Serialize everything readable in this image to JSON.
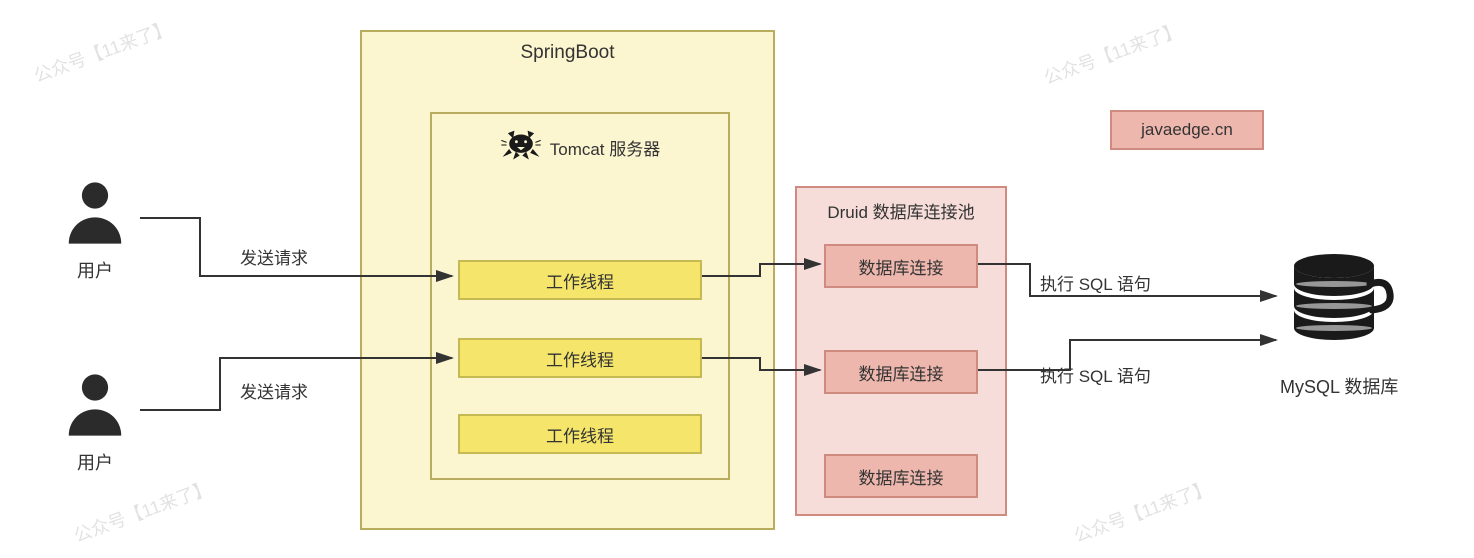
{
  "watermark": "公众号【11来了】",
  "users": {
    "label": "用户"
  },
  "springboot": {
    "title": "SpringBoot",
    "tomcat": {
      "title": "Tomcat 服务器",
      "workers": [
        "工作线程",
        "工作线程",
        "工作线程"
      ]
    }
  },
  "druid": {
    "title": "Druid 数据库连接池",
    "connections": [
      "数据库连接",
      "数据库连接",
      "数据库连接"
    ]
  },
  "mysql": {
    "label": "MySQL 数据库"
  },
  "badge": "javaedge.cn",
  "flow": {
    "send_request": "发送请求",
    "exec_sql": "执行 SQL 语句"
  }
}
